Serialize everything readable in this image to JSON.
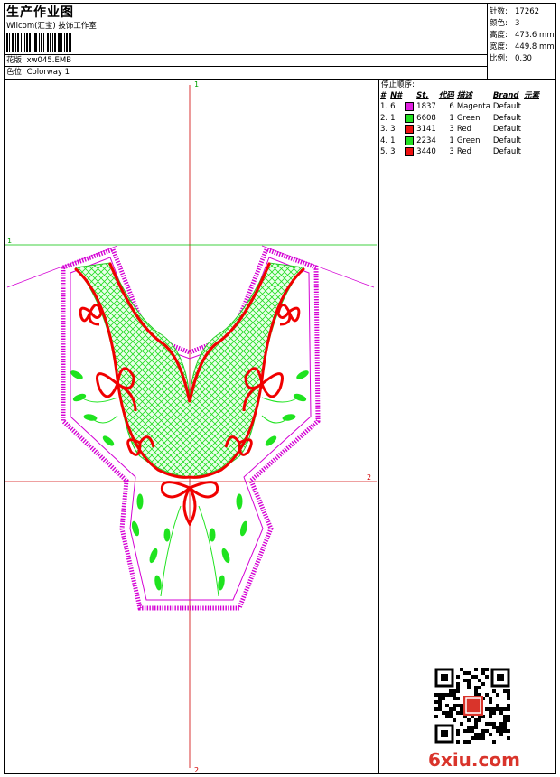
{
  "header": {
    "title": "生产作业图",
    "company": "Wilcom(汇宝) 技饰工作室",
    "design_label": "花版:",
    "design_value": "xw045.EMB",
    "colorway_label": "色位:",
    "colorway_value": "Colorway 1"
  },
  "stats": [
    {
      "label": "针数:",
      "value": "17262"
    },
    {
      "label": "颜色:",
      "value": "3"
    },
    {
      "label": "高度:",
      "value": "473.6 mm"
    },
    {
      "label": "宽度:",
      "value": "449.8 mm"
    },
    {
      "label": "比例:",
      "value": "0.30"
    }
  ],
  "stop_sequence": {
    "title": "停止顺序:",
    "columns": [
      "#",
      "N#",
      "St.",
      "代码",
      "描述",
      "Brand",
      "元素"
    ],
    "rows": [
      {
        "idx": "1.",
        "n": "6",
        "code": "1837",
        "st": "6",
        "desc": "Magenta",
        "brand": "Default",
        "color": "#e020e0"
      },
      {
        "idx": "2.",
        "n": "1",
        "code": "6608",
        "st": "1",
        "desc": "Green",
        "brand": "Default",
        "color": "#22e022"
      },
      {
        "idx": "3.",
        "n": "3",
        "code": "3141",
        "st": "3",
        "desc": "Red",
        "brand": "Default",
        "color": "#ee1111"
      },
      {
        "idx": "4.",
        "n": "1",
        "code": "2234",
        "st": "1",
        "desc": "Green",
        "brand": "Default",
        "color": "#22e022"
      },
      {
        "idx": "5.",
        "n": "3",
        "code": "3440",
        "st": "3",
        "desc": "Red",
        "brand": "Default",
        "color": "#ee1111"
      }
    ]
  },
  "markers": {
    "top_v": "1",
    "left_h": "1",
    "right_h": "2",
    "bottom_v": "2"
  },
  "colors": {
    "magenta": "#d400d4",
    "green": "#1fe31f",
    "red": "#f00000",
    "guide_red": "#d00000",
    "guide_green": "#00c000"
  },
  "watermark": "6xiu.com"
}
